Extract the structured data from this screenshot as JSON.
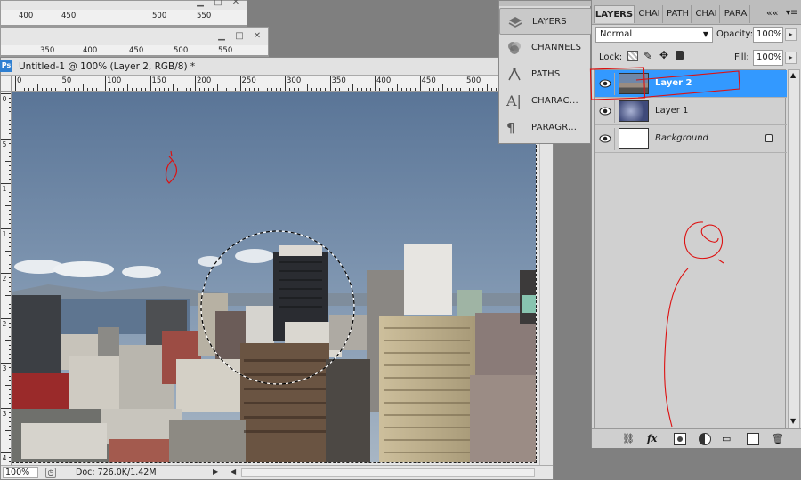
{
  "bg_windows": [
    {
      "ruler_labels": [
        "400",
        "450",
        "500",
        "550"
      ]
    },
    {
      "ruler_labels": [
        "350",
        "400",
        "450",
        "500",
        "550"
      ]
    }
  ],
  "document": {
    "ps_badge": "Ps",
    "title": "Untitled-1 @ 100% (Layer 2, RGB/8) *",
    "ruler_labels": [
      "0",
      "50",
      "100",
      "150",
      "200",
      "250",
      "300",
      "350",
      "400",
      "450",
      "500",
      "550"
    ],
    "vruler_labels": [
      "0",
      "5",
      "1",
      "1",
      "2",
      "2",
      "3",
      "3",
      "4"
    ],
    "zoom": "100%",
    "doc_info": "Doc: 726.0K/1.42M"
  },
  "dock": {
    "items": [
      {
        "label": "LAYERS",
        "icon": "layers-icon"
      },
      {
        "label": "CHANNELS",
        "icon": "channels-icon"
      },
      {
        "label": "PATHS",
        "icon": "paths-icon"
      },
      {
        "label": "CHARAC...",
        "icon": "character-icon"
      },
      {
        "label": "PARAGR...",
        "icon": "paragraph-icon"
      }
    ]
  },
  "layers_panel": {
    "tabs": [
      "LAYERS",
      "CHAI",
      "PATH",
      "CHAI",
      "PARA"
    ],
    "tab_arrows": "««",
    "menu_glyph": "▾≡",
    "blend_mode": "Normal",
    "opacity_label": "Opacity:",
    "opacity_value": "100%",
    "lock_label": "Lock:",
    "fill_label": "Fill:",
    "fill_value": "100%",
    "layers": [
      {
        "name": "Layer 2",
        "selected": true,
        "italic": false
      },
      {
        "name": "Layer 1",
        "selected": false,
        "italic": false
      },
      {
        "name": "Background",
        "selected": false,
        "italic": true,
        "locked": true
      }
    ],
    "footer_icons": [
      "link-icon",
      "fx-icon",
      "mask-icon",
      "adjustment-icon",
      "folder-icon",
      "new-layer-icon",
      "trash-icon"
    ],
    "fx_label": "fx"
  },
  "colors": {
    "selection_blue": "#3399ff",
    "annotation_red": "#dd1111",
    "panel_bg": "#d6d6d6",
    "workspace": "#7f7f7f"
  }
}
